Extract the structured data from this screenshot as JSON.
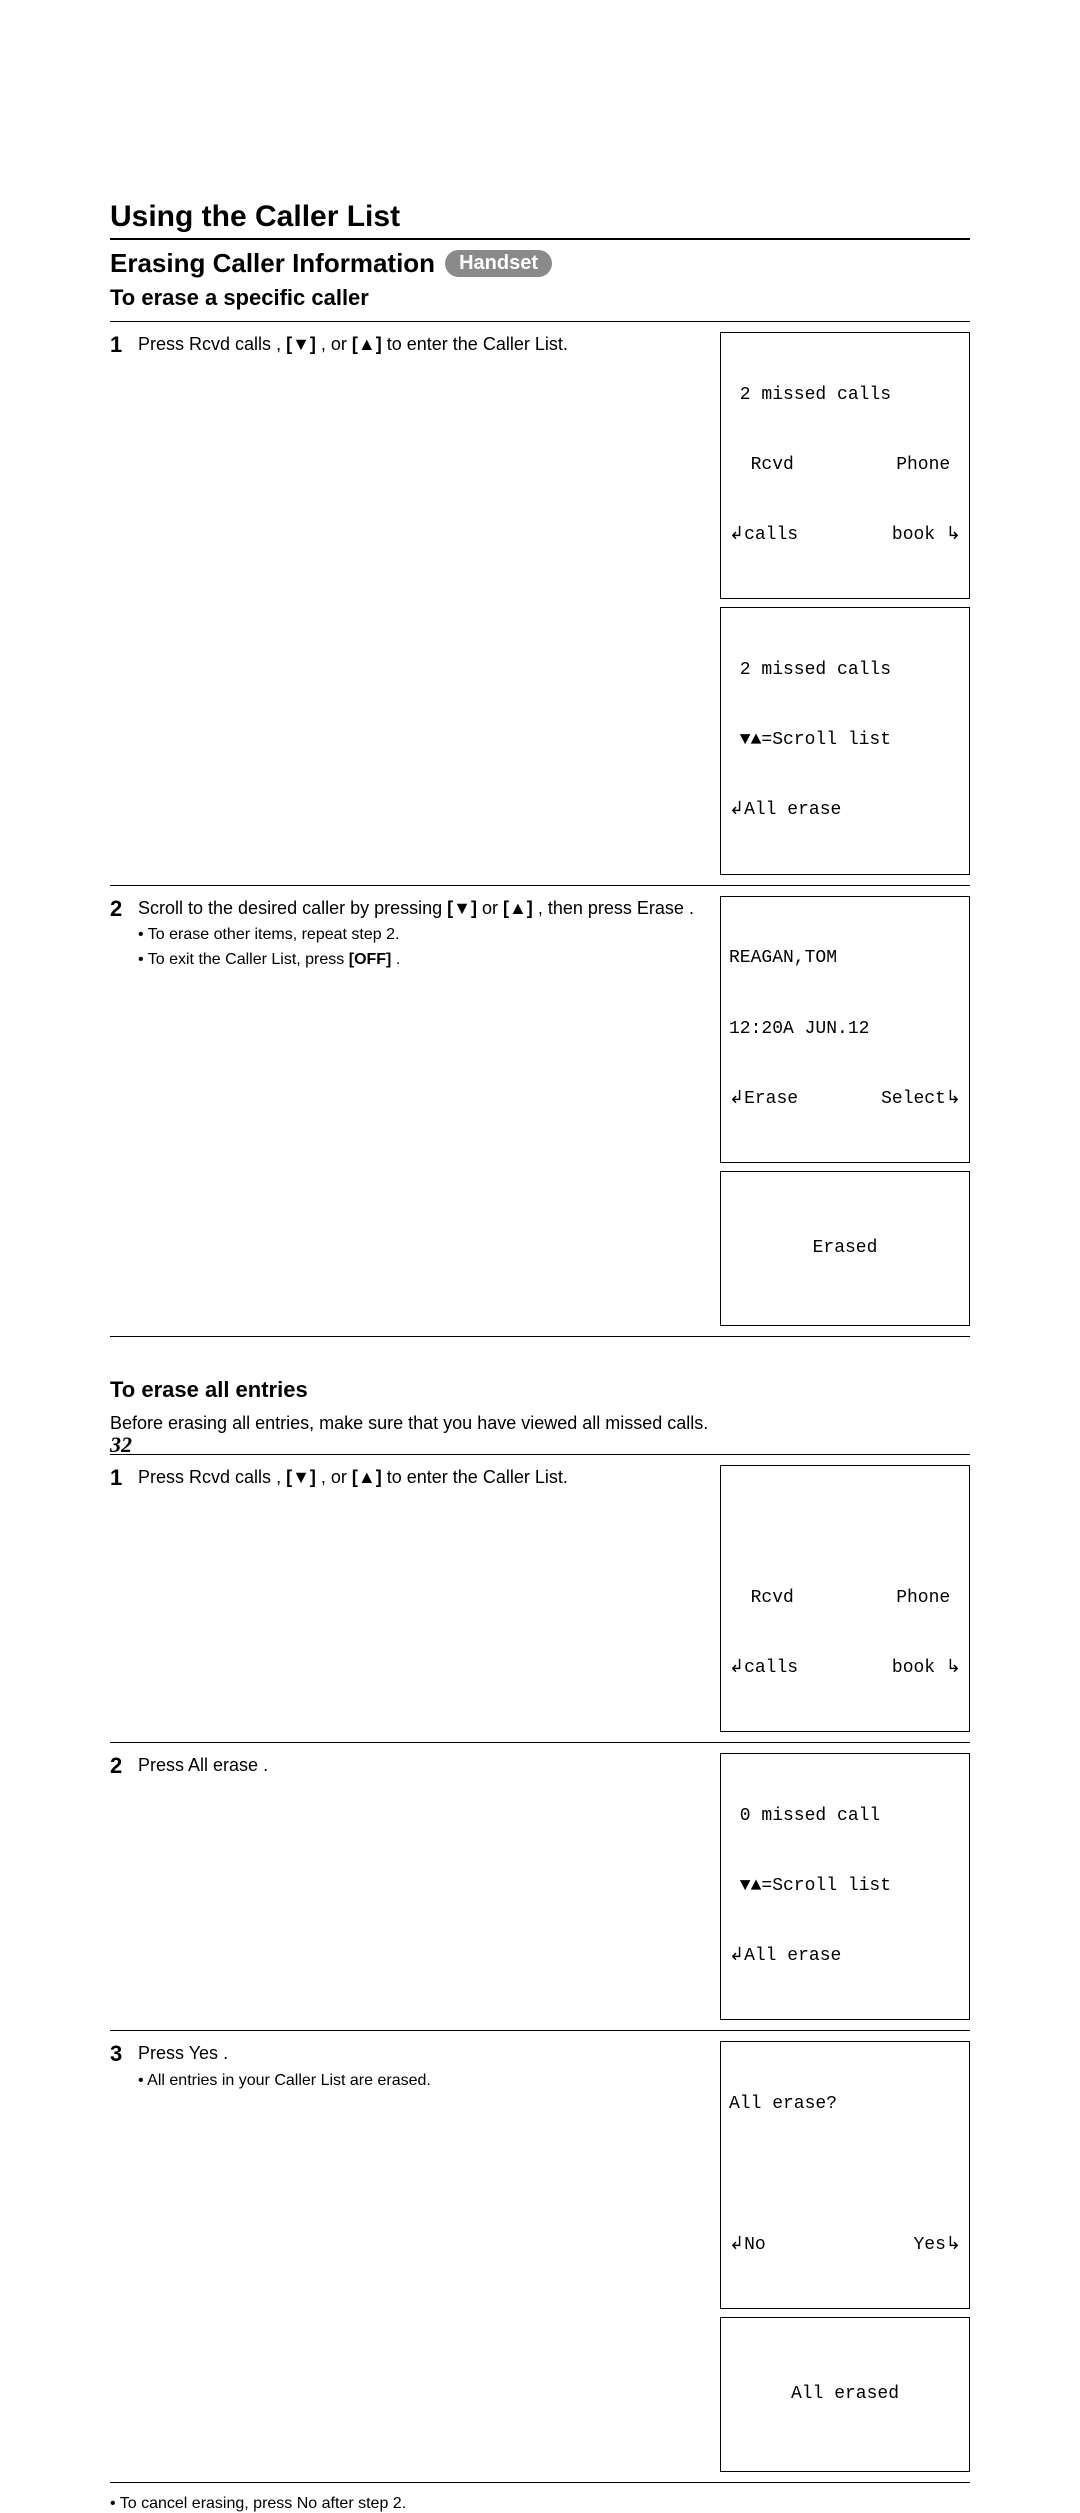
{
  "title_main": "Using the Caller List",
  "subtitle": "Erasing Caller Information",
  "badge": "Handset",
  "sec1": {
    "heading": "To erase a specific caller",
    "step1": {
      "num": "1",
      "pre": "Press ",
      "btn": "Rcvd calls",
      "mid": " , ",
      "key1": "[▼]",
      "conj": ", or ",
      "key2": "[▲]",
      "post": " to enter the Caller List."
    },
    "screen1a": {
      "line1": " 2 missed calls",
      "left2": "  Rcvd",
      "right2": "Phone ",
      "left3": "↲calls",
      "right3": "book ↳"
    },
    "screen1b": {
      "line1": " 2 missed calls",
      "line2": " ▼▲=Scroll list",
      "line3": "↲All erase"
    },
    "step2": {
      "num": "2",
      "pre": "Scroll to the desired caller by pressing ",
      "key1": "[▼]",
      "conj": " or ",
      "key2": "[▲]",
      "mid": ", then press ",
      "btn": "Erase",
      "post": " .",
      "sub1": "• To erase other items, repeat step 2.",
      "sub2_pre": "• To exit the Caller List, press ",
      "sub2_key": "[OFF]",
      "sub2_post": "."
    },
    "screen2a": {
      "line1": "REAGAN,TOM",
      "line2": "12:20A JUN.12",
      "left3": "↲Erase",
      "right3": "Select↳"
    },
    "screen2b": {
      "center": "Erased"
    }
  },
  "sec2": {
    "heading": "To erase all entries",
    "note": "Before erasing all entries, make sure that you have viewed all missed calls.",
    "step1": {
      "num": "1",
      "pre": "Press ",
      "btn": "Rcvd calls",
      "mid": " , ",
      "key1": "[▼]",
      "conj": ", or ",
      "key2": "[▲]",
      "post": " to enter the Caller List."
    },
    "screen1": {
      "line1": " ",
      "left2": "  Rcvd",
      "right2": "Phone ",
      "left3": "↲calls",
      "right3": "book ↳"
    },
    "step2": {
      "num": "2",
      "pre": "Press ",
      "btn": "All erase",
      "post": " ."
    },
    "screen2": {
      "line1": " 0 missed call",
      "line2": " ▼▲=Scroll list",
      "line3": "↲All erase"
    },
    "step3": {
      "num": "3",
      "pre": "Press ",
      "btn": "Yes",
      "post": ".",
      "sub": "• All entries in your Caller List are erased."
    },
    "screen3a": {
      "line1": "All erase?",
      "line2_blank": " ",
      "left3": "↲No",
      "right3": "Yes↳"
    },
    "screen3b": {
      "center": "All erased"
    },
    "footnote_pre": "• To cancel erasing, press ",
    "footnote_btn": "No",
    "footnote_post": " after step 2."
  },
  "page_num": "32"
}
